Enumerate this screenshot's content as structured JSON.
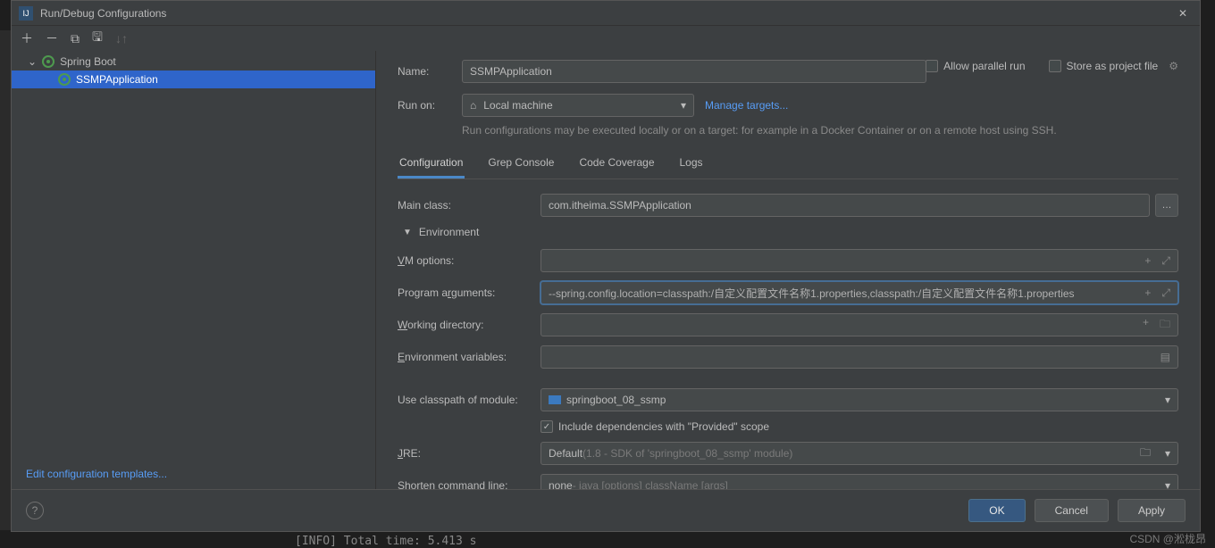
{
  "window": {
    "title": "Run/Debug Configurations"
  },
  "tree": {
    "root_label": "Spring Boot",
    "selected_label": "SSMPApplication"
  },
  "sidebar": {
    "edit_templates": "Edit configuration templates..."
  },
  "form": {
    "name_label": "Name:",
    "name_value": "SSMPApplication",
    "allow_parallel": "Allow parallel run",
    "store_project": "Store as project file",
    "run_on_label": "Run on:",
    "run_on_value": "Local machine",
    "manage_targets": "Manage targets...",
    "hint": "Run configurations may be executed locally or on a target: for example in a Docker Container or on a remote host using SSH."
  },
  "tabs": [
    "Configuration",
    "Grep Console",
    "Code Coverage",
    "Logs"
  ],
  "config": {
    "main_class_label": "Main class:",
    "main_class_value": "com.itheima.SSMPApplication",
    "env_header": "Environment",
    "vm_label": "VM options:",
    "args_label": "Program arguments:",
    "args_value": "--spring.config.location=classpath:/自定义配置文件名称1.properties,classpath:/自定义配置文件名称1.properties",
    "workdir_label": "Working directory:",
    "envvars_label": "Environment variables:",
    "classpath_label": "Use classpath of module:",
    "classpath_value": "springboot_08_ssmp",
    "include_deps": "Include dependencies with \"Provided\" scope",
    "jre_label": "JRE:",
    "jre_value": "Default",
    "jre_dim": " (1.8 - SDK of 'springboot_08_ssmp' module)",
    "shorten_label": "Shorten command line:",
    "shorten_value": "none",
    "shorten_dim": " - java [options] className [args]"
  },
  "footer": {
    "ok": "OK",
    "cancel": "Cancel",
    "apply": "Apply"
  },
  "watermark": "CSDN @淞栊昂",
  "console": "[INFO] Total time:  5.413 s"
}
